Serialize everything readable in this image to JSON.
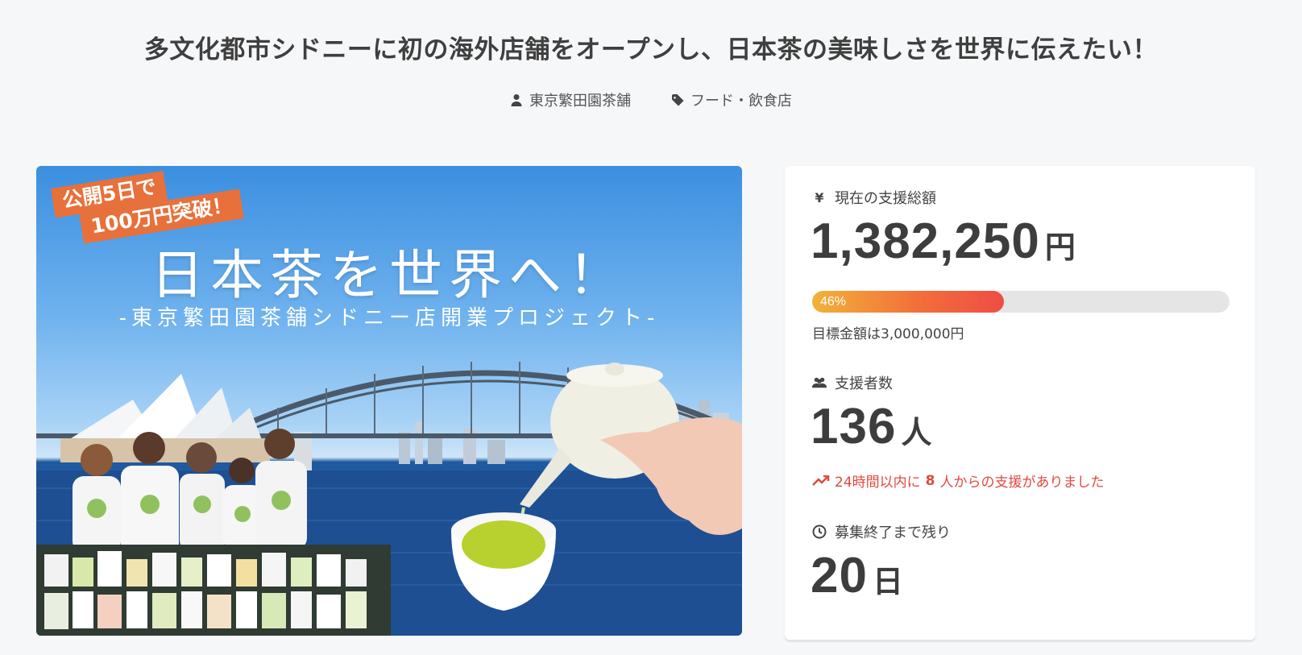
{
  "project": {
    "title": "多文化都市シドニーに初の海外店舗をオープンし、日本茶の美味しさを世界に伝えたい！",
    "owner": "東京繁田園茶舗",
    "category": "フード・飲食店"
  },
  "hero": {
    "badge_line1": "公開5日で",
    "badge_line2": "100万円突破！",
    "headline": "日本茶を世界へ！",
    "subheadline": "-東京繁田園茶舗シドニー店開業プロジェクト-"
  },
  "stats": {
    "amount_label": "現在の支援総額",
    "amount": "1,382,250",
    "amount_unit": "円",
    "progress_percent": 46,
    "progress_label": "46%",
    "goal_text": "目標金額は3,000,000円",
    "supporters_label": "支援者数",
    "supporters": "136",
    "supporters_unit": "人",
    "recent_prefix": "24時間以内に",
    "recent_count": "8",
    "recent_suffix": "人からの支援がありました",
    "remaining_label": "募集終了まで残り",
    "remaining": "20",
    "remaining_unit": "日"
  },
  "colors": {
    "accent_orange": "#e8703a",
    "progress_start": "#f2b23a",
    "progress_end": "#ee4d45",
    "recent_red": "#e04a3f"
  },
  "icons": {
    "owner": "user-icon",
    "category": "tag-icon",
    "amount": "yen-icon",
    "supporters": "users-icon",
    "recent": "trending-up-icon",
    "remaining": "clock-icon"
  }
}
